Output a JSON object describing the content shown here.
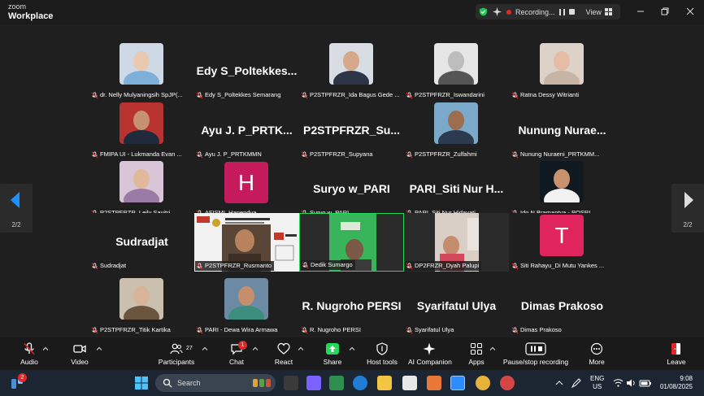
{
  "app": {
    "logo_line1": "zoom",
    "logo_line2": "Workplace",
    "recording_label": "Recording...",
    "view_label": "View"
  },
  "gallery": {
    "page_indicator": "2/2",
    "tiles": [
      {
        "name": "dr. Nelly Mulyaningsih SpJP(...",
        "big": "",
        "kind": "photo",
        "bg": "#cfd9e6",
        "face": "#e9c9b0",
        "cloth": "#7fb0d9"
      },
      {
        "name": "Edy S_Poltekkes Semarang",
        "big": "Edy S_Poltekkes...",
        "kind": "name"
      },
      {
        "name": "P2STPFRZR_Ida Bagus Gede ...",
        "big": "",
        "kind": "photo",
        "bg": "#d8dde3",
        "face": "#d7a98b",
        "cloth": "#2c3648"
      },
      {
        "name": "P2STPFRZR_Iswandarini",
        "big": "",
        "kind": "photo",
        "bg": "#e6e6e6",
        "face": "#bdbdbd",
        "cloth": "#555555"
      },
      {
        "name": "Ratna Dessy Witrianti",
        "big": "",
        "kind": "photo",
        "bg": "#dcd2c8",
        "face": "#e6bca4",
        "cloth": "#c7b4a4"
      },
      {
        "name": "FMIPA UI - Lukmanda Evan ...",
        "big": "",
        "kind": "photo",
        "bg": "#b8322f",
        "face": "#c69074",
        "cloth": "#1f2a3a"
      },
      {
        "name": "Ayu J. P_PRTKMMN",
        "big": "Ayu J. P_PRTK...",
        "kind": "name"
      },
      {
        "name": "P2STPFRZR_Supyana",
        "big": "P2STPFRZR_Su...",
        "kind": "name"
      },
      {
        "name": "P2STPFRZR_Zulfahmi",
        "big": "",
        "kind": "photo",
        "bg": "#7aa9c9",
        "face": "#9c6d4e",
        "cloth": "#2b3a4f"
      },
      {
        "name": "Nunung Nuraeni_PRTKMM...",
        "big": "Nunung Nurae...",
        "kind": "name"
      },
      {
        "name": "P2STPFRZR_Leily Savitri",
        "big": "",
        "kind": "photo",
        "bg": "#d8c6d8",
        "face": "#e1b89a",
        "cloth": "#9b7aa5"
      },
      {
        "name": "AFISMI_Hanendya",
        "big": "",
        "kind": "letter",
        "letter": "H",
        "bg": "#c51a5b"
      },
      {
        "name": "Suryo w_PARI",
        "big": "Suryo w_PARI",
        "kind": "name"
      },
      {
        "name": "PARI_Siti Nur Hidayati",
        "big": "PARI_Siti Nur H...",
        "kind": "name"
      },
      {
        "name": "Ido N Bramantya - POSRI",
        "big": "",
        "kind": "photo",
        "bg": "#101820",
        "face": "#c9926f",
        "cloth": "#f2f2f2"
      },
      {
        "name": "Sudradjat",
        "big": "Sudradjat",
        "kind": "name"
      },
      {
        "name": "P2STPFRZR_Rusmanto",
        "big": "",
        "kind": "video-slide"
      },
      {
        "name": "Dedik Sumargo",
        "big": "",
        "kind": "video-green"
      },
      {
        "name": "DP2FRZR_Dyah Palupi",
        "big": "",
        "kind": "video-room"
      },
      {
        "name": "Siti Rahayu_Di Mutu Yankes ...",
        "big": "",
        "kind": "letter",
        "letter": "T",
        "bg": "#e0245e"
      },
      {
        "name": "P2STPFRZR_Titik Kartika",
        "big": "",
        "kind": "photo",
        "bg": "#cbbfae",
        "face": "#d8b49b",
        "cloth": "#6b5440"
      },
      {
        "name": "PARI - Dewa Wira Armawa",
        "big": "",
        "kind": "photo",
        "bg": "#6c8aa3",
        "face": "#c68f6c",
        "cloth": "#3d8e7f"
      },
      {
        "name": "R. Nugroho PERSI",
        "big": "R. Nugroho PERSI",
        "kind": "name"
      },
      {
        "name": "Syarifatul Ulya",
        "big": "Syarifatul Ulya",
        "kind": "name"
      },
      {
        "name": "Dimas Prakoso",
        "big": "Dimas Prakoso",
        "kind": "name"
      }
    ]
  },
  "toolbar": {
    "audio": "Audio",
    "video": "Video",
    "participants": "Participants",
    "participants_count": "27",
    "chat": "Chat",
    "chat_badge": "1",
    "react": "React",
    "share": "Share",
    "host_tools": "Host tools",
    "ai_companion": "AI Companion",
    "apps": "Apps",
    "record": "Pause/stop recording",
    "more": "More",
    "leave": "Leave"
  },
  "taskbar": {
    "widget_badge": "2",
    "search_placeholder": "Search",
    "lang_line1": "ENG",
    "lang_line2": "US",
    "time": "9:08",
    "date": "01/08/2025"
  },
  "colors": {
    "active_speaker": "#23d959",
    "share_green": "#23d959",
    "leave_red": "#e02828",
    "muted_red": "#e02828"
  }
}
